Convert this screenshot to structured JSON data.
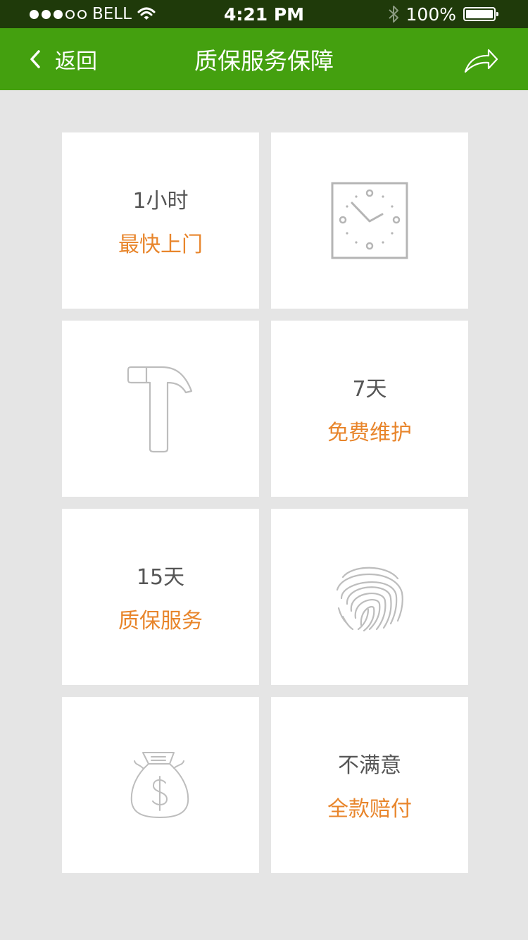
{
  "status_bar": {
    "carrier": "BELL",
    "time": "4:21 PM",
    "battery": "100%",
    "signal_icons": [
      "signal-dots-icon",
      "wifi-icon"
    ],
    "right_icons": [
      "bluetooth-icon",
      "battery-icon"
    ]
  },
  "nav": {
    "back_label": "返回",
    "title": "质保服务保障",
    "back_icon": "chevron-left-icon",
    "share_icon": "share-icon"
  },
  "colors": {
    "nav_bg": "#44a00f",
    "status_bg": "#1f3a0a",
    "accent": "#e8852b",
    "page_bg": "#e5e5e5",
    "icon_gray": "#b5b5b5"
  },
  "tiles": [
    {
      "kind": "text",
      "top": "1小时",
      "bottom": "最快上门"
    },
    {
      "kind": "icon",
      "icon": "clock-icon"
    },
    {
      "kind": "icon",
      "icon": "hammer-icon"
    },
    {
      "kind": "text",
      "top": "7天",
      "bottom": "免费维护"
    },
    {
      "kind": "text",
      "top": "15天",
      "bottom": "质保服务"
    },
    {
      "kind": "icon",
      "icon": "fingerprint-icon"
    },
    {
      "kind": "icon",
      "icon": "money-bag-icon"
    },
    {
      "kind": "text",
      "top": "不满意",
      "bottom": "全款赔付"
    }
  ]
}
